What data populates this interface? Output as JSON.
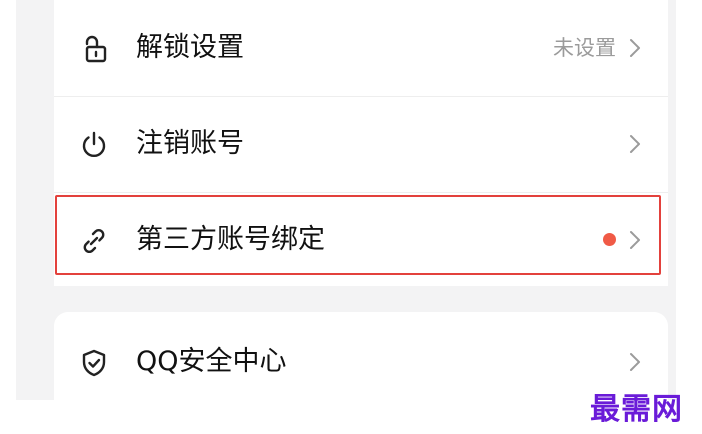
{
  "settings": {
    "items": [
      {
        "label": "解锁设置",
        "value": "未设置",
        "icon": "unlock-icon"
      },
      {
        "label": "注销账号",
        "icon": "power-icon"
      },
      {
        "label": "第三方账号绑定",
        "icon": "link-icon",
        "badge": "red-dot"
      }
    ]
  },
  "security": {
    "items": [
      {
        "label": "QQ安全中心",
        "icon": "shield-check-icon"
      }
    ]
  },
  "colors": {
    "highlight": "#e3413c",
    "badge": "#f05a46",
    "watermark": "#6a1bd8",
    "background": "#f3f3f4"
  },
  "watermark": "最需网"
}
